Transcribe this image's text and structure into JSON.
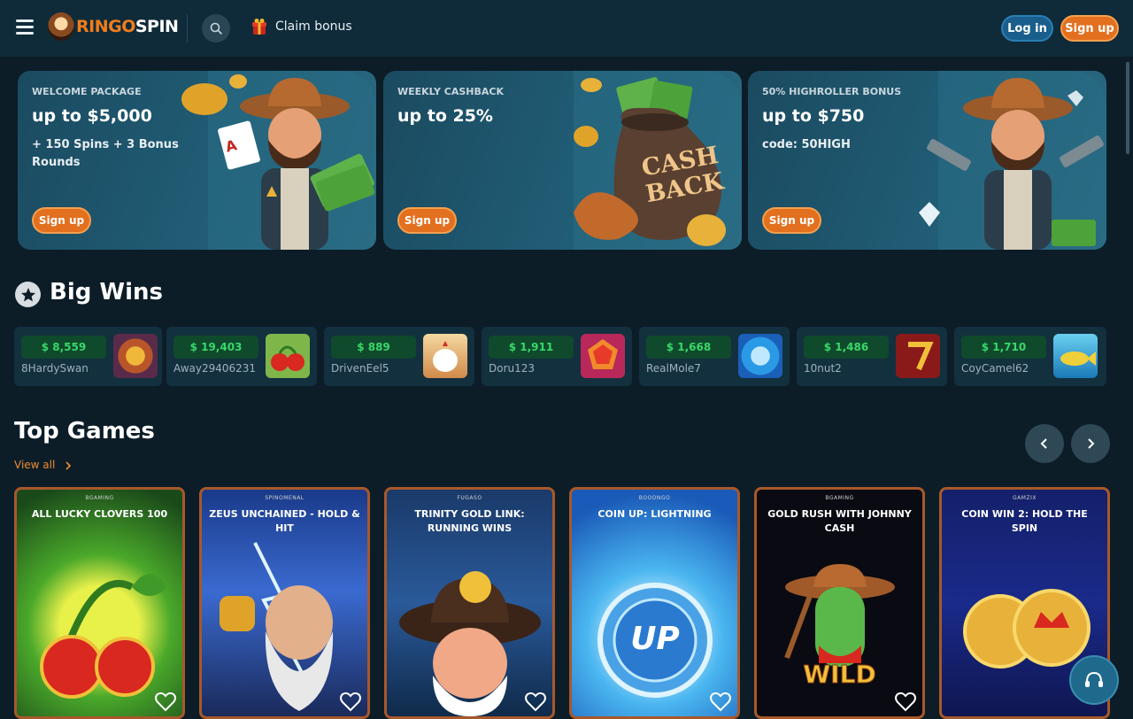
{
  "header": {
    "logo_ringo": "RINGO",
    "logo_spin": "SPIN",
    "claim_bonus": "Claim bonus",
    "login": "Log in",
    "signup": "Sign up"
  },
  "promos": [
    {
      "kicker": "WELCOME PACKAGE",
      "title": "up to $5,000",
      "sub": "+ 150 Spins + 3 Bonus Rounds",
      "button": "Sign up"
    },
    {
      "kicker": "WEEKLY CASHBACK",
      "title": "up to 25%",
      "sub": "",
      "button": "Sign up",
      "art_text": "CASH BACK"
    },
    {
      "kicker": "50% HIGHROLLER BONUS",
      "title": "up to $750",
      "sub": "code: 50HIGH",
      "button": "Sign up"
    }
  ],
  "big_wins": {
    "title": "Big Wins",
    "items": [
      {
        "amount": "$ 8,559",
        "user": "8HardySwan"
      },
      {
        "amount": "$ 19,403",
        "user": "Away29406231"
      },
      {
        "amount": "$ 889",
        "user": "DrivenEel5"
      },
      {
        "amount": "$ 1,911",
        "user": "Doru123"
      },
      {
        "amount": "$ 1,668",
        "user": "RealMole7"
      },
      {
        "amount": "$ 1,486",
        "user": "10nut2"
      },
      {
        "amount": "$ 1,710",
        "user": "CoyCamel62"
      }
    ]
  },
  "top_games": {
    "title": "Top Games",
    "view_all": "View all",
    "items": [
      {
        "provider": "BGAMING",
        "title": "ALL LUCKY CLOVERS 100",
        "art_text": ""
      },
      {
        "provider": "SPINOMENAL",
        "title": "ZEUS UNCHAINED - HOLD & HIT",
        "art_text": ""
      },
      {
        "provider": "FUGASO",
        "title": "TRINITY GOLD LINK: RUNNING WINS",
        "art_text": ""
      },
      {
        "provider": "BOOONGO",
        "title": "COIN UP: LIGHTNING",
        "art_text": "UP"
      },
      {
        "provider": "BGAMING",
        "title": "GOLD RUSH WITH JOHNNY CASH",
        "art_text": "WILD"
      },
      {
        "provider": "GAMZIX",
        "title": "COIN WIN 2: HOLD THE SPIN",
        "art_text": ""
      }
    ]
  },
  "colors": {
    "background": "#0c1d28",
    "header": "#0f2a39",
    "accent_orange": "#e2701f",
    "login_blue": "#1a5f8c",
    "win_green": "#38d86a"
  },
  "icons": {
    "menu": "hamburger-icon",
    "search": "search-icon",
    "claim": "gift-icon",
    "big_wins": "star-icon",
    "prev": "chevron-left-icon",
    "next": "chevron-right-icon",
    "favorite": "heart-icon",
    "support": "headset-icon"
  }
}
